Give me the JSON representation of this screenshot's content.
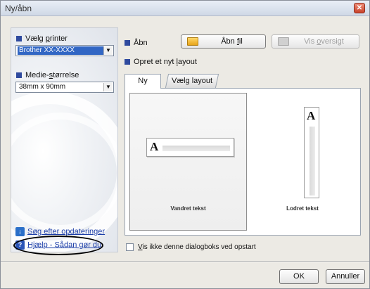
{
  "window": {
    "title": "Ny/åbn",
    "close_glyph": "✕"
  },
  "left": {
    "printer_label_pre": "Vælg ",
    "printer_label_u": "p",
    "printer_label_post": "rinter",
    "printer_value": "Brother XX-XXXX",
    "media_label_pre": "Medie-",
    "media_label_u": "s",
    "media_label_post": "tørrelse",
    "media_value": "38mm x 90mm",
    "update_link": "Søg efter opdateringer",
    "help_link": "Hjælp - Sådan gør du"
  },
  "open": {
    "label": "Åbn",
    "open_file_pre": "Åbn ",
    "open_file_u": "f",
    "open_file_post": "il",
    "show_overview_pre": "Vis ",
    "show_overview_u": "o",
    "show_overview_post": "versigt"
  },
  "create": {
    "label_pre": "Opret et nyt ",
    "label_u": "l",
    "label_post": "ayout"
  },
  "tabs": {
    "new": "Ny",
    "choose_layout": "Vælg layout"
  },
  "layouts": {
    "horizontal": "Vandret tekst",
    "vertical": "Lodret tekst",
    "glyph": "A"
  },
  "checkbox": {
    "label_pre": "",
    "label_u": "V",
    "label_post": "is ikke denne dialogboks ved opstart"
  },
  "buttons": {
    "ok": "OK",
    "cancel": "Annuller"
  },
  "colors": {
    "accent": "#2f4a9e",
    "selection": "#3166c4",
    "link": "#1c3ea8"
  }
}
